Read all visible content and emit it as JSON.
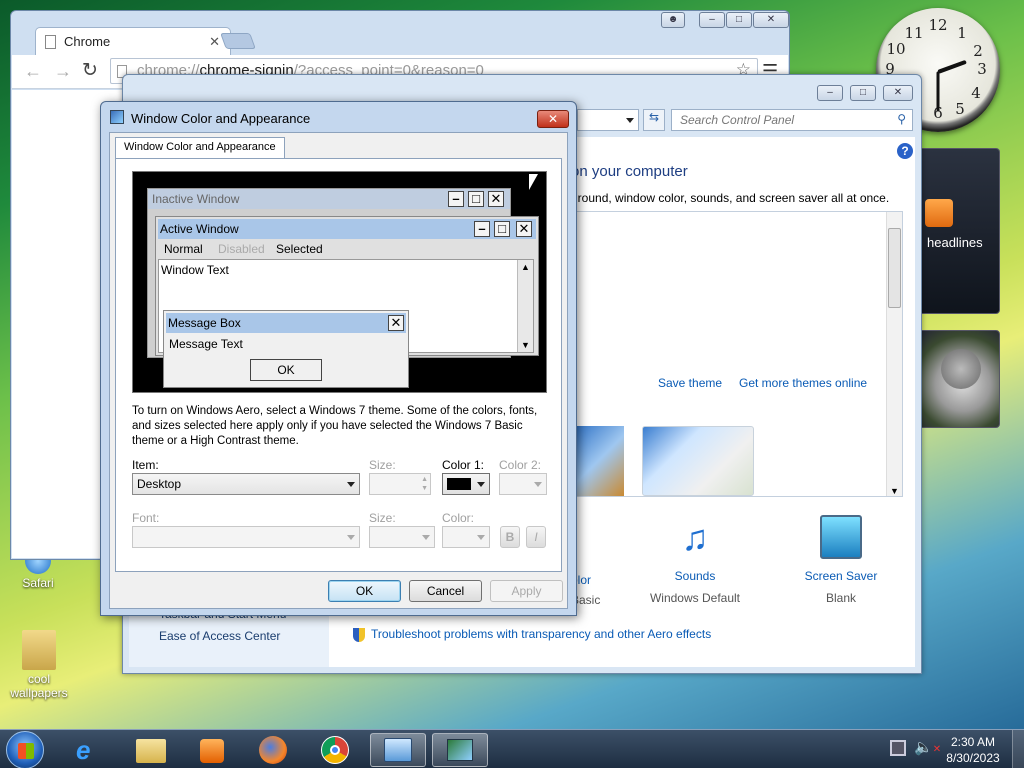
{
  "desktop": {
    "icons": [
      {
        "label": "Safari"
      },
      {
        "label": "cool wallpapers"
      }
    ]
  },
  "clock": {
    "numbers": [
      "12",
      "1",
      "2",
      "3",
      "4",
      "5",
      "6",
      "7",
      "8",
      "9",
      "10",
      "11"
    ]
  },
  "gadgets": {
    "feed_label": "headlines"
  },
  "chrome": {
    "tab_title": "Chrome",
    "address_scheme": "chrome://",
    "address_host": "chrome-signin",
    "address_path": "/?access_point=0&reason=0"
  },
  "control_panel": {
    "search_placeholder": "Search Control Panel",
    "heading": "on your computer",
    "subheading": "ground, window color, sounds, and screen saver all at once.",
    "save_theme": "Save theme",
    "get_more_themes": "Get more themes online",
    "color_label": "olor",
    "color_value": "Basic",
    "sounds_label": "Sounds",
    "sounds_value": "Windows Default",
    "screensaver_label": "Screen Saver",
    "screensaver_value": "Blank",
    "taskbar_link": "Taskbar and Start Menu",
    "ease_link": "Ease of Access Center",
    "troubleshoot_link": "Troubleshoot problems with transparency and other Aero effects"
  },
  "dialog": {
    "title": "Window Color and Appearance",
    "tab": "Window Color and Appearance",
    "preview": {
      "inactive_title": "Inactive Window",
      "active_title": "Active Window",
      "menu_normal": "Normal",
      "menu_disabled": "Disabled",
      "menu_selected": "Selected",
      "window_text": "Window Text",
      "message_box_title": "Message Box",
      "message_text": "Message Text",
      "ok": "OK"
    },
    "description": "To turn on Windows Aero, select a Windows 7 theme.  Some of the colors, fonts, and sizes selected here apply only if you have selected the Windows 7 Basic theme or a High Contrast theme.",
    "item_label": "Item:",
    "item_value": "Desktop",
    "size_label": "Size:",
    "color1_label": "Color 1:",
    "color1_value": "#000000",
    "color2_label": "Color 2:",
    "font_label": "Font:",
    "font_size_label": "Size:",
    "font_color_label": "Color:",
    "bold": "B",
    "italic": "I",
    "ok": "OK",
    "cancel": "Cancel",
    "apply": "Apply"
  },
  "taskbar": {
    "time": "2:30 AM",
    "date": "8/30/2023"
  }
}
